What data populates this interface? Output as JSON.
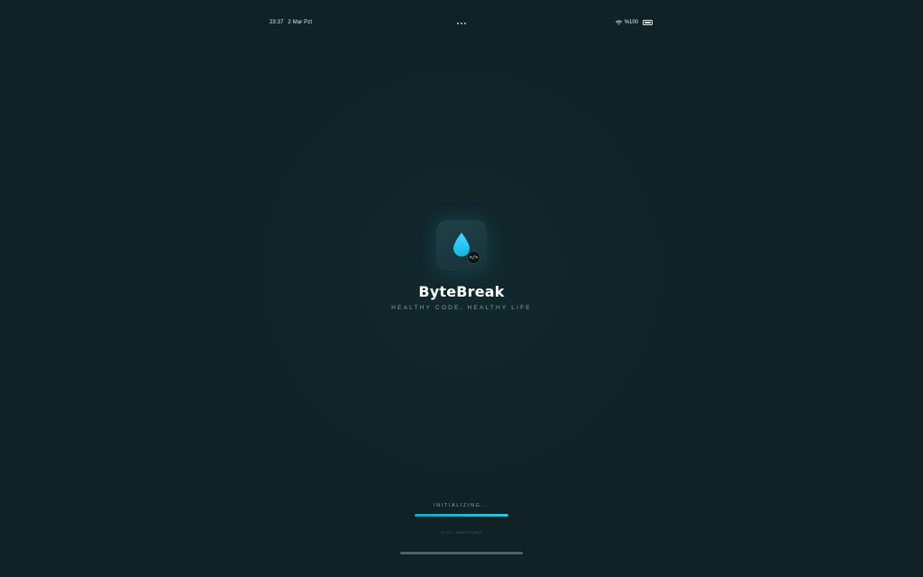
{
  "status_bar": {
    "time": "23:37",
    "date": "2 Mar Pzt",
    "battery": "%100",
    "battery_level": 1.0,
    "icons": [
      "wifi-icon",
      "battery-icon",
      "more-dots-icon"
    ]
  },
  "splash": {
    "app_name": "ByteBreak",
    "tagline": "HEALTHY CODE, HEALTHY LIFE",
    "icon": "water-drop-icon",
    "badge_icon": "code-icon",
    "badge_text": "</>",
    "accent_color": "#1fb6e0",
    "background_color": "#102226"
  },
  "loading": {
    "label": "INITIALIZING...",
    "progress": 1.0
  },
  "footer": {
    "text": "v1.0.2 · Made for Devs"
  }
}
